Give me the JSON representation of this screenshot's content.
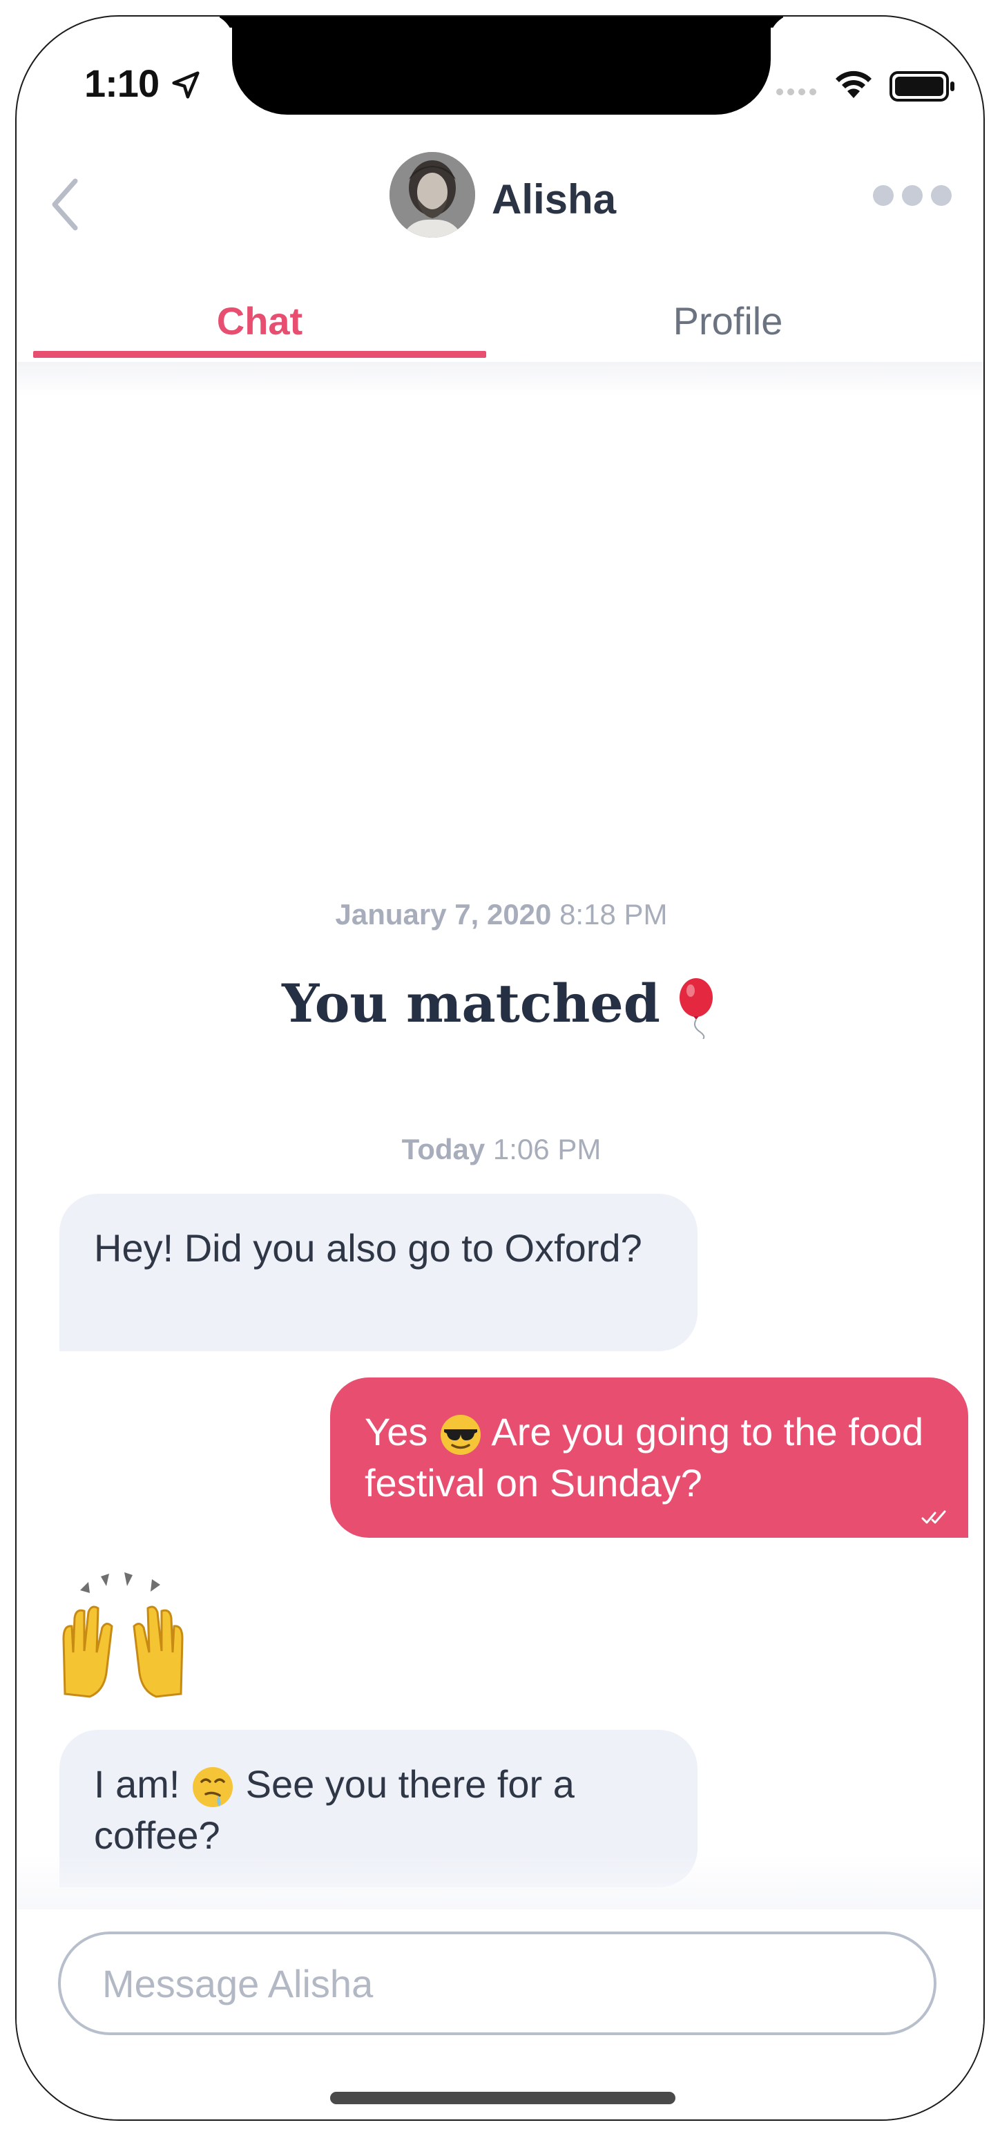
{
  "status_bar": {
    "time": "1:10"
  },
  "header": {
    "contact_name": "Alisha",
    "tabs": [
      {
        "label": "Chat",
        "active": true
      },
      {
        "label": "Profile",
        "active": false
      }
    ]
  },
  "chat": {
    "match_date": {
      "date": "January 7, 2020",
      "time": "8:18 PM"
    },
    "match_title": "You matched",
    "today_date": {
      "date": "Today",
      "time": "1:06 PM"
    },
    "messages": [
      {
        "direction": "incoming",
        "text": "Hey! Did you also go to Oxford?"
      },
      {
        "direction": "outgoing",
        "text_before": "Yes",
        "emoji": "sunglasses-face",
        "text_after": "Are you going to the food festival on Sunday?",
        "read": true
      },
      {
        "direction": "incoming",
        "emoji_only": "raising-hands"
      },
      {
        "direction": "incoming",
        "text_before": "I am!",
        "emoji": "drooling-face",
        "text_after": "See you there for a coffee?"
      }
    ]
  },
  "composer": {
    "placeholder": "Message Alisha"
  },
  "colors": {
    "accent": "#e84e70",
    "incoming_bubble": "#eef1f8",
    "text_dark": "#2b3444",
    "muted": "#a7adba"
  }
}
